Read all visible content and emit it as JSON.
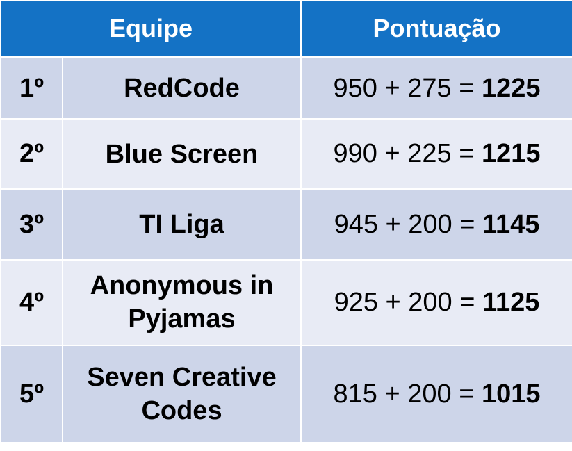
{
  "header": {
    "team": "Equipe",
    "score": "Pontuação"
  },
  "rows": [
    {
      "rank": "1º",
      "team": "RedCode",
      "expression": "950 + 275 =",
      "total": "1225"
    },
    {
      "rank": "2º",
      "team": "Blue Screen",
      "expression": "990 + 225 =",
      "total": "1215"
    },
    {
      "rank": "3º",
      "team": "TI Liga",
      "expression": "945 + 200 =",
      "total": "1145"
    },
    {
      "rank": "4º",
      "team": "Anonymous in Pyjamas",
      "expression": "925 + 200 =",
      "total": "1125"
    },
    {
      "rank": "5º",
      "team": "Seven Creative Codes",
      "expression": "815 + 200 =",
      "total": "1015"
    }
  ],
  "colors": {
    "header_bg": "#1472c5",
    "row_dark": "#cdd5e9",
    "row_light": "#e8ebf5"
  }
}
